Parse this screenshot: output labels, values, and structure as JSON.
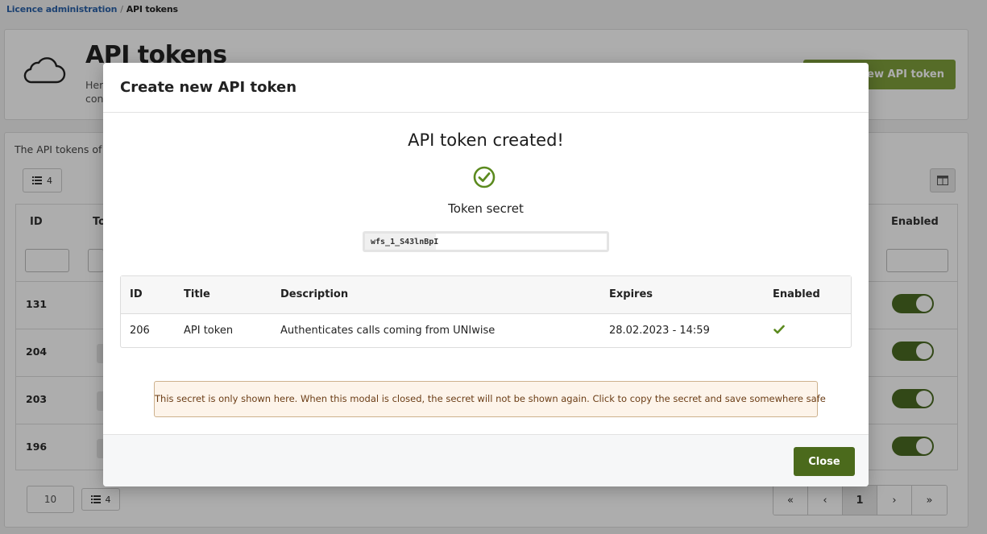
{
  "breadcrumb": {
    "parent": "Licence administration",
    "separator": "/",
    "current": "API tokens"
  },
  "header": {
    "title": "API tokens",
    "description": "Her\ncon",
    "new_button": "new API token"
  },
  "list": {
    "caption": "The API tokens of t",
    "count_badge": "4",
    "columns": {
      "id": "ID",
      "token": "To",
      "enabled": "Enabled"
    },
    "rows": [
      {
        "id": "131"
      },
      {
        "id": "204"
      },
      {
        "id": "203"
      },
      {
        "id": "196"
      }
    ],
    "page_size": "10",
    "pager": {
      "first": "«",
      "prev": "‹",
      "page": "1",
      "next": "›",
      "last": "»"
    }
  },
  "modal": {
    "title": "Create new API token",
    "success_message": "API token created!",
    "secret_label": "Token secret",
    "secret_value": "wfs_1_S43lnBpI",
    "table": {
      "headers": {
        "id": "ID",
        "title": "Title",
        "description": "Description",
        "expires": "Expires",
        "enabled": "Enabled"
      },
      "row": {
        "id": "206",
        "title": "API token",
        "description": "Authenticates calls coming from UNIwise",
        "expires": "28.02.2023 - 14:59",
        "enabled": true
      }
    },
    "warning": "This secret is only shown here. When this modal is closed, the secret will not be shown again. Click to copy the secret and save somewhere safe",
    "close_button": "Close"
  },
  "colors": {
    "primary": "#4b6a1c",
    "check": "#5b8a1e",
    "link": "#2b62a8",
    "warning_bg": "#fdf4ea",
    "warning_border": "#cdb18d"
  }
}
